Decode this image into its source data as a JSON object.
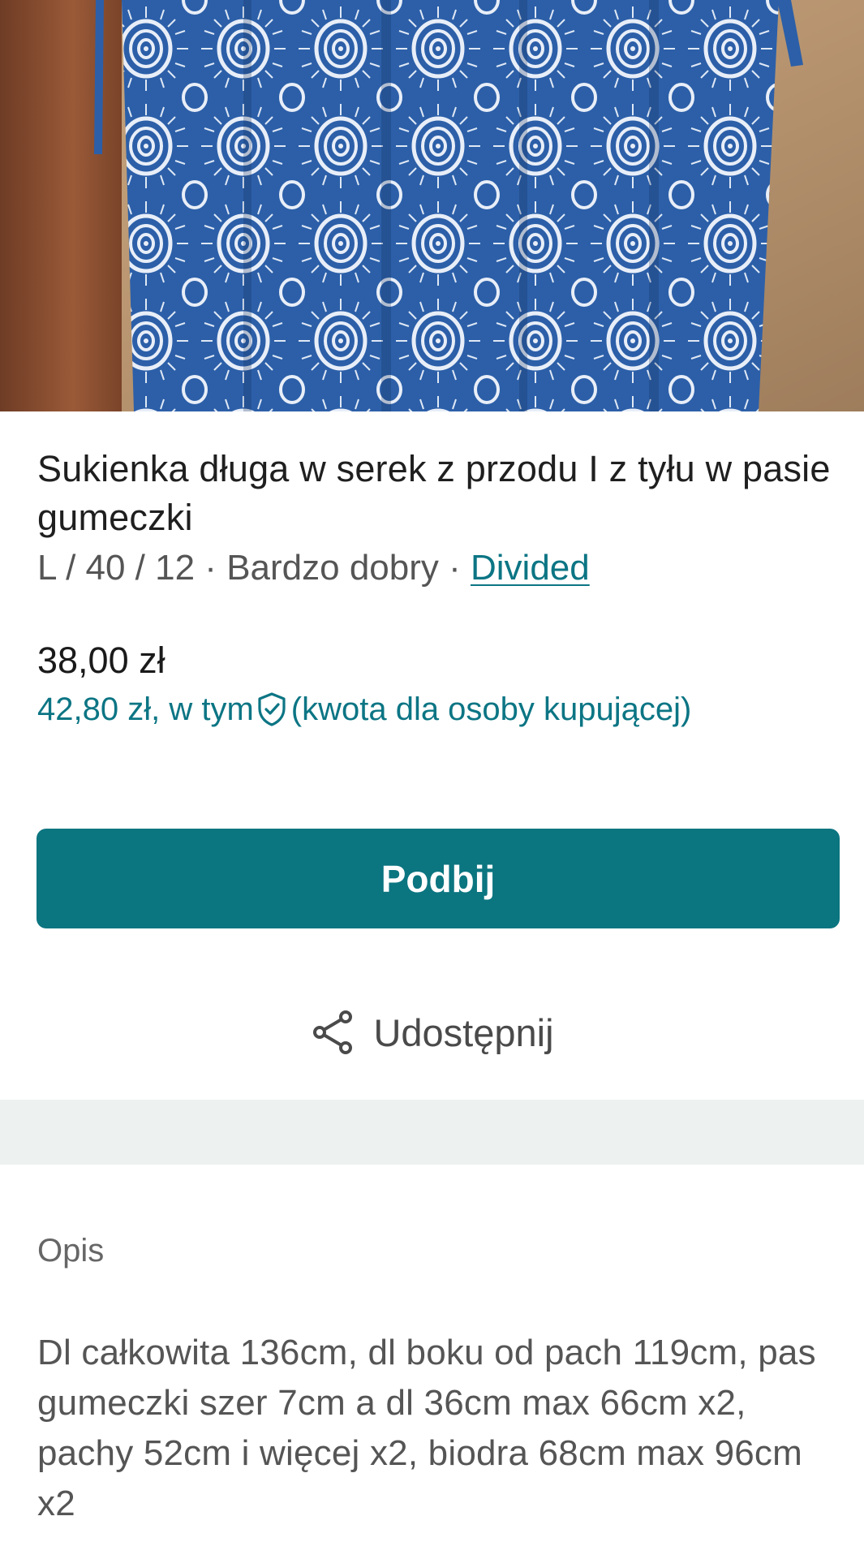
{
  "product": {
    "title": "Sukienka długa w serek z przodu I z tyłu w pasie gumeczki",
    "size": "L / 40 / 12",
    "separator_1": " · ",
    "condition": "Bardzo dobry",
    "separator_2": " · ",
    "brand": "Divided",
    "price": "38,00 zł",
    "buyer_price": "42,80 zł, w tym",
    "buyer_price_note": "(kwota dla osoby kupującej)"
  },
  "actions": {
    "bump_label": "Podbij",
    "share_label": "Udostępnij"
  },
  "description": {
    "heading": "Opis",
    "text": "Dl całkowita 136cm, dl boku od pach 119cm, pas gumeczki szer 7cm a dl 36cm max 66cm x2, pachy 52cm i więcej x2, biodra 68cm max 96cm x2"
  },
  "icons": {
    "shield": "shield-check-icon",
    "share": "share-icon"
  },
  "colors": {
    "accent": "#0b7580",
    "link": "#0c7584",
    "band": "#edf1f0"
  }
}
